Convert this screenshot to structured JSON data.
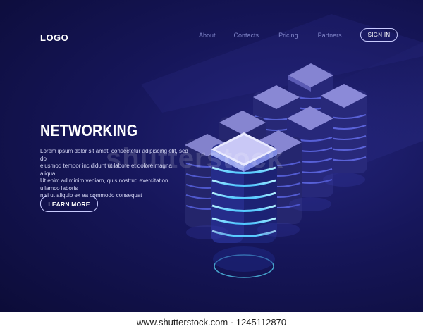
{
  "header": {
    "logo": "LOGO",
    "nav": [
      "About",
      "Contacts",
      "Pricing",
      "Partners"
    ],
    "signin": "SIGN IN"
  },
  "hero": {
    "title": "NETWORKING",
    "body_lines": [
      "Lorem ipsum dolor sit amet, consectetur adipiscing elit, sed do",
      "eiusmod tempor incididunt ut labore et dolore magna aliqua",
      "Ut enim ad minim veniam, quis nostrud exercitation ullamco laboris",
      "nisi ut aliquip ex ea commodo consequat"
    ],
    "cta": "LEARN MORE"
  },
  "watermark": {
    "overlay": "shutterstock",
    "footer": "www.shutterstock.com · 1245112870"
  },
  "colors": {
    "bg_dark": "#0c0c38",
    "bg_mid": "#23247a",
    "accent_glow": "#6fe3ff",
    "server_top": "#8b8ad8"
  }
}
